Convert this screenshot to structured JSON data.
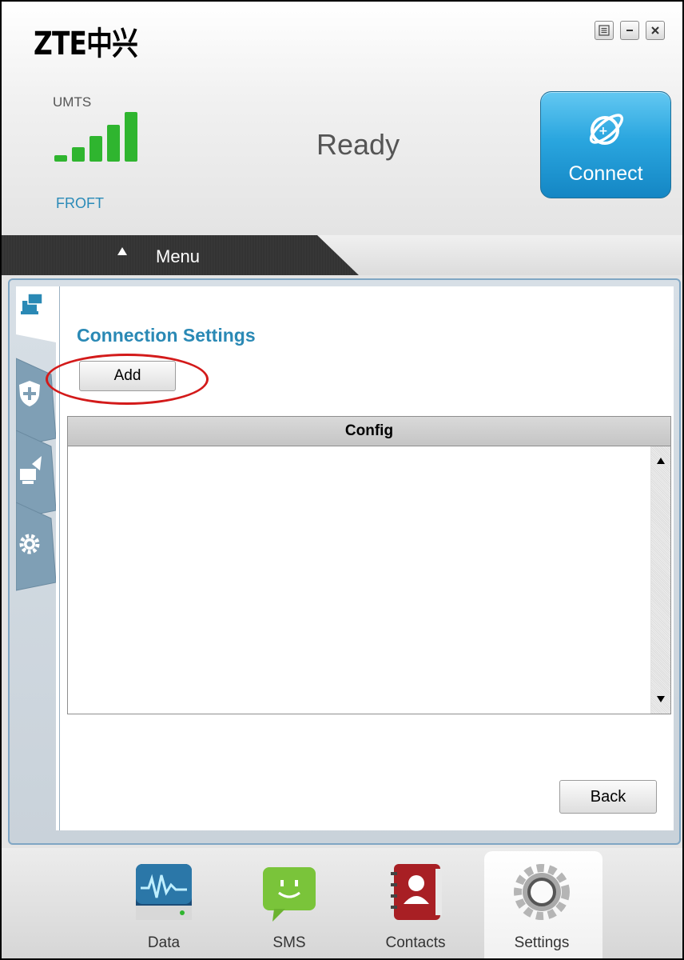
{
  "app": {
    "logo_text": "ZTE中兴",
    "colors": {
      "accent": "#2a89b5",
      "connect_button": "#2aa6df",
      "signal": "#2fb52f",
      "highlight": "#d31a1a"
    }
  },
  "window_controls": [
    {
      "name": "options",
      "icon": "options-icon"
    },
    {
      "name": "minimize",
      "icon": "minimize-icon"
    },
    {
      "name": "close",
      "icon": "close-icon"
    }
  ],
  "status": {
    "network_type": "UMTS",
    "operator": "FROFT",
    "state": "Ready",
    "signal_bars": 5,
    "connect_label": "Connect"
  },
  "menu": {
    "label": "Menu"
  },
  "side_tabs": [
    {
      "icon": "network-icon",
      "active": true
    },
    {
      "icon": "shield-icon",
      "active": false
    },
    {
      "icon": "antenna-icon",
      "active": false
    },
    {
      "icon": "gear-icon",
      "active": false
    }
  ],
  "settings_page": {
    "title": "Connection Settings",
    "add_label": "Add",
    "table": {
      "header": "Config",
      "rows": []
    },
    "back_label": "Back"
  },
  "dock": [
    {
      "label": "Data",
      "icon": "data-icon"
    },
    {
      "label": "SMS",
      "icon": "sms-icon"
    },
    {
      "label": "Contacts",
      "icon": "contacts-icon"
    },
    {
      "label": "Settings",
      "icon": "settings-icon",
      "active": true
    }
  ]
}
